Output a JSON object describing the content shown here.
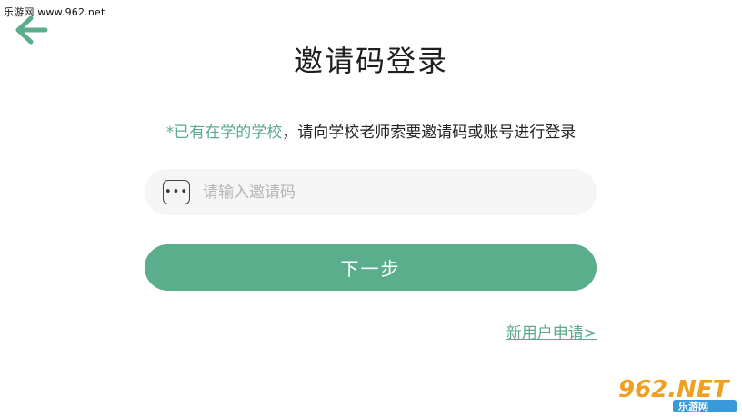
{
  "watermark_top": "乐游网 www.962.net",
  "header": {
    "back_icon": "arrow-left-icon",
    "title": "邀请码登录"
  },
  "hint": {
    "accent": "*已有在学的学校",
    "rest": "，请向学校老师索要邀请码或账号进行登录"
  },
  "invite_input": {
    "icon": "dots-keypad-icon",
    "icon_glyph": "•••",
    "placeholder": "请输入邀请码",
    "value": ""
  },
  "next_button": {
    "label": "下一步"
  },
  "apply_link": {
    "label": "新用户申请>"
  },
  "logo": {
    "top": "962.NET",
    "bottom": "乐游网"
  },
  "colors": {
    "accent": "#5aae8c",
    "input_bg": "#f5f5f5"
  }
}
